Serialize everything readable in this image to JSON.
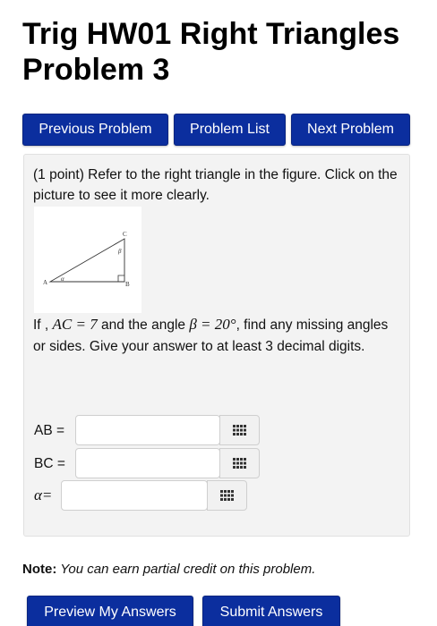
{
  "page": {
    "title_line1": "Trig HW01 Right Triangles",
    "title_line2": "Problem 3"
  },
  "nav": {
    "previous": "Previous Problem",
    "list": "Problem List",
    "next": "Next Problem"
  },
  "problem": {
    "intro": "(1 point) Refer to the right triangle in the figure. Click on the picture to see it more clearly.",
    "figure_labels": {
      "A": "A",
      "B": "B",
      "C": "C",
      "alpha": "α",
      "beta": "β"
    },
    "question_prefix": "If , ",
    "ac_expr": "AC = 7",
    "question_mid": " and the angle ",
    "beta_expr": "β = 20°",
    "question_suffix": ", find any missing angles or sides. Give your answer to at least 3 decimal digits."
  },
  "answers": {
    "ab_label": "AB =",
    "bc_label": "BC =",
    "alpha_label": "α=",
    "ab_value": "",
    "bc_value": "",
    "alpha_value": ""
  },
  "note": {
    "bold": "Note:",
    "text": " You can earn partial credit on this problem."
  },
  "actions": {
    "preview": "Preview My Answers",
    "submit": "Submit Answers"
  },
  "colors": {
    "button_bg": "#0b2e9e",
    "panel_bg": "#f3f3f3"
  }
}
